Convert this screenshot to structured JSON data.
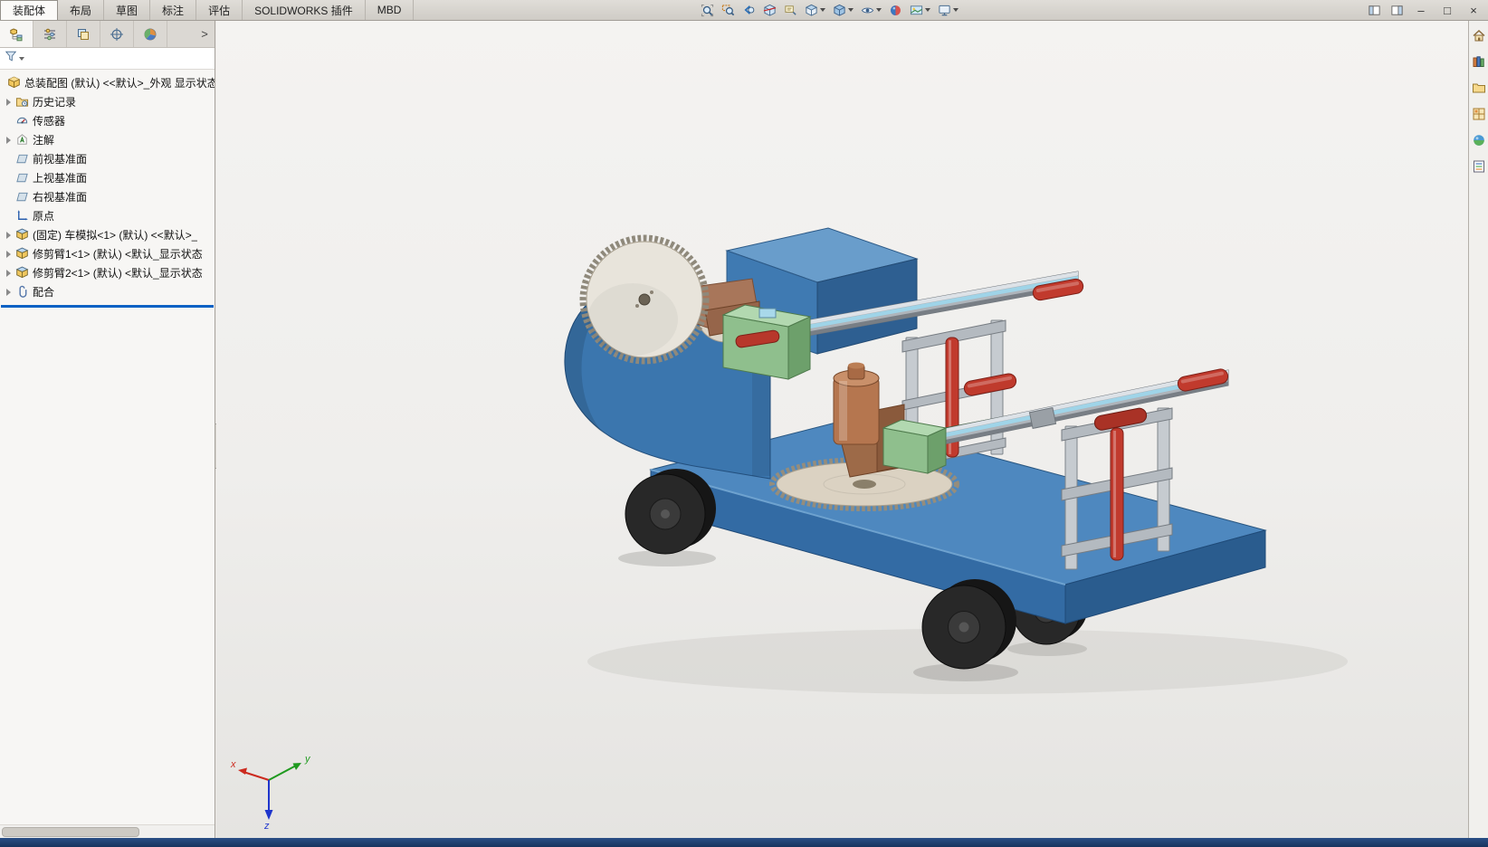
{
  "colors": {
    "rollback_bar": "#0b61c4",
    "status_bar": "#1e3f74",
    "model_body_blue": "#3b76ae",
    "saw_blade_beige": "#e8e4db",
    "actuator_red": "#c13a2d",
    "mount_green": "#8fbf8d"
  },
  "command_bar": {
    "tabs": [
      {
        "label": "装配体",
        "active": true
      },
      {
        "label": "布局",
        "active": false
      },
      {
        "label": "草图",
        "active": false
      },
      {
        "label": "标注",
        "active": false
      },
      {
        "label": "评估",
        "active": false
      },
      {
        "label": "SOLIDWORKS 插件",
        "active": false
      },
      {
        "label": "MBD",
        "active": false
      }
    ]
  },
  "headsup_toolbar": {
    "icons": [
      {
        "name": "zoom-to-fit-icon",
        "dropdown": false
      },
      {
        "name": "zoom-to-area-icon",
        "dropdown": false
      },
      {
        "name": "previous-view-icon",
        "dropdown": false
      },
      {
        "name": "section-view-icon",
        "dropdown": false
      },
      {
        "name": "dynamic-annotation-view-icon",
        "dropdown": false
      },
      {
        "name": "view-orientation-icon",
        "dropdown": true
      },
      {
        "name": "display-style-icon",
        "dropdown": true
      },
      {
        "name": "hide-show-items-icon",
        "dropdown": true
      },
      {
        "name": "edit-appearance-icon",
        "dropdown": false
      },
      {
        "name": "apply-scene-icon",
        "dropdown": true
      },
      {
        "name": "view-settings-icon",
        "dropdown": true
      }
    ]
  },
  "window_controls": {
    "pane_toggles": [
      {
        "name": "options-pane-toggle-icon"
      },
      {
        "name": "task-pane-toggle-icon"
      }
    ],
    "minimize": "–",
    "maximize": "□",
    "close": "×"
  },
  "feature_panel": {
    "tabs": [
      {
        "name": "featuremanager-tab",
        "icon": "featuremanager-icon",
        "active": true
      },
      {
        "name": "propertymanager-tab",
        "icon": "propertymanager-icon",
        "active": false
      },
      {
        "name": "configurationmanager-tab",
        "icon": "configurationmanager-icon",
        "active": false
      },
      {
        "name": "dimxpertmanager-tab",
        "icon": "dimxpert-icon",
        "active": false
      },
      {
        "name": "displaymanager-tab",
        "icon": "displaymanager-icon",
        "active": false
      }
    ],
    "expand_arrow": ">",
    "filter": {
      "icon": "filter-icon"
    },
    "tree": {
      "items": [
        {
          "label": "总装配图 (默认) <<默认>_外观 显示状态",
          "icon": "assembly-icon",
          "arrow": false,
          "root": true
        },
        {
          "label": "历史记录",
          "icon": "history-icon",
          "arrow": true,
          "root": false
        },
        {
          "label": "传感器",
          "icon": "sensors-icon",
          "arrow": false,
          "root": false
        },
        {
          "label": "注解",
          "icon": "annotations-icon",
          "arrow": true,
          "root": false
        },
        {
          "label": "前视基准面",
          "icon": "plane-icon",
          "arrow": false,
          "root": false
        },
        {
          "label": "上视基准面",
          "icon": "plane-icon",
          "arrow": false,
          "root": false
        },
        {
          "label": "右视基准面",
          "icon": "plane-icon",
          "arrow": false,
          "root": false
        },
        {
          "label": "原点",
          "icon": "origin-icon",
          "arrow": false,
          "root": false
        },
        {
          "label": "(固定) 车模拟<1> (默认) <<默认>_",
          "icon": "component-icon",
          "arrow": true,
          "root": false
        },
        {
          "label": "修剪臂1<1> (默认) <默认_显示状态",
          "icon": "component-icon",
          "arrow": true,
          "root": false
        },
        {
          "label": "修剪臂2<1> (默认) <默认_显示状态",
          "icon": "component-icon",
          "arrow": true,
          "root": false
        },
        {
          "label": "配合",
          "icon": "mates-icon",
          "arrow": true,
          "root": false
        }
      ]
    }
  },
  "task_pane": {
    "icons": [
      {
        "name": "solidworks-resources-icon"
      },
      {
        "name": "design-library-icon"
      },
      {
        "name": "file-explorer-icon"
      },
      {
        "name": "view-palette-icon"
      },
      {
        "name": "appearances-scenes-icon"
      },
      {
        "name": "custom-properties-icon"
      }
    ]
  },
  "viewport": {
    "triad": {
      "x": "x",
      "y": "y",
      "z": "z"
    }
  },
  "status_bar": {
    "text": ""
  }
}
